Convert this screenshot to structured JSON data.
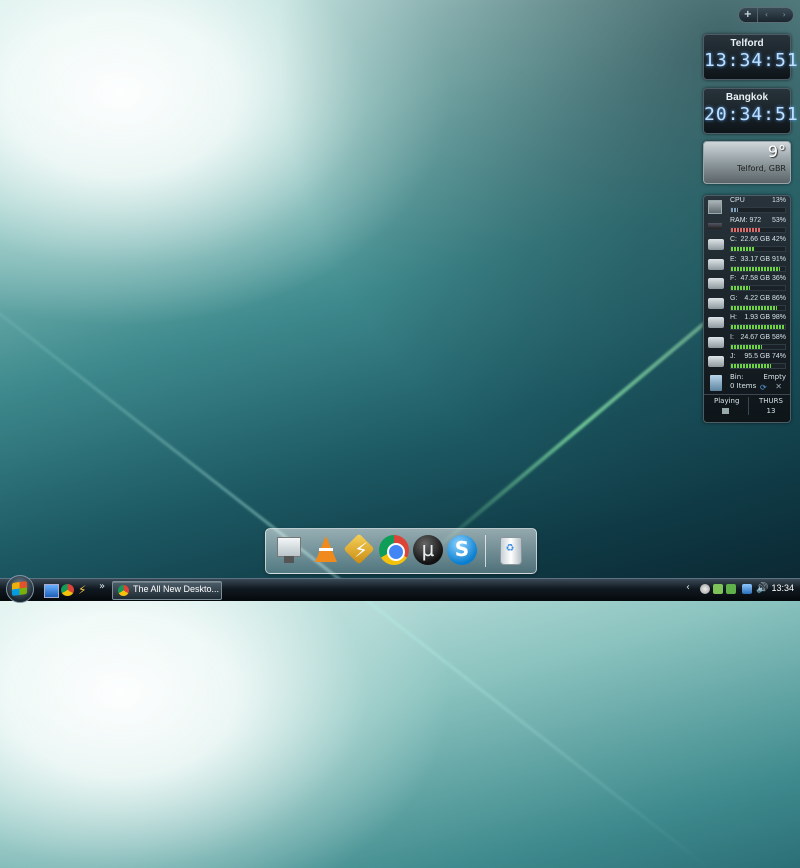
{
  "sidebar_controls": {
    "add": "+",
    "prev": "‹",
    "next": "›"
  },
  "clocks": [
    {
      "city": "Telford",
      "time": "13:34:51"
    },
    {
      "city": "Bangkok",
      "time": "20:34:51"
    }
  ],
  "weather": {
    "temperature": "9°",
    "location": "Telford, GBR"
  },
  "monitor": {
    "cpu": {
      "label": "CPU",
      "value": "13%",
      "percent": 13
    },
    "ram": {
      "label": "RAM: 972",
      "value": "53%",
      "percent": 53
    },
    "drives": [
      {
        "letter": "C:",
        "value": "22.66 GB 42%",
        "percent": 42
      },
      {
        "letter": "E:",
        "value": "33.17 GB 91%",
        "percent": 91
      },
      {
        "letter": "F:",
        "value": "47.58 GB 36%",
        "percent": 36
      },
      {
        "letter": "G:",
        "value": "4.22 GB 86%",
        "percent": 86
      },
      {
        "letter": "H:",
        "value": "1.93 GB 98%",
        "percent": 98
      },
      {
        "letter": "I:",
        "value": "24.67 GB 58%",
        "percent": 58
      },
      {
        "letter": "J:",
        "value": "95.5 GB 74%",
        "percent": 74
      }
    ],
    "bin": {
      "label": "Bin:",
      "items": "0 Items",
      "status": "Empty"
    },
    "media": {
      "label": "Playing"
    },
    "date": {
      "day": "THURS",
      "date": "13"
    }
  },
  "dock": [
    "computer",
    "vlc",
    "winamp",
    "chrome",
    "utorrent",
    "skype",
    "recycle-bin"
  ],
  "taskbar": {
    "task_label": "The All New Deskto...",
    "more_glyph": "»",
    "tray_chevron": "‹",
    "clock": "13:34"
  }
}
